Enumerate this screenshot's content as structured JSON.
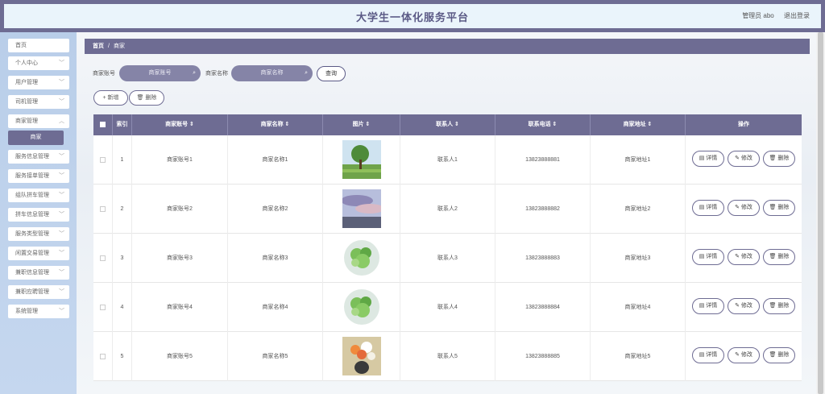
{
  "header": {
    "title": "大学生一体化服务平台",
    "user_label": "管理员 abo",
    "logout": "退出登录"
  },
  "sidebar": {
    "items": [
      {
        "label": "首页",
        "has_children": false
      },
      {
        "label": "个人中心",
        "has_children": true
      },
      {
        "label": "用户管理",
        "has_children": true
      },
      {
        "label": "司机管理",
        "has_children": true
      },
      {
        "label": "商家管理",
        "has_children": true
      },
      {
        "label": "服务信息管理",
        "has_children": true
      },
      {
        "label": "服务接单管理",
        "has_children": true
      },
      {
        "label": "组队拼车管理",
        "has_children": true
      },
      {
        "label": "拼车信息管理",
        "has_children": true
      },
      {
        "label": "服务类型管理",
        "has_children": true
      },
      {
        "label": "闲置交易管理",
        "has_children": true
      },
      {
        "label": "兼职信息管理",
        "has_children": true
      },
      {
        "label": "兼职应聘管理",
        "has_children": true
      },
      {
        "label": "系统管理",
        "has_children": true
      }
    ],
    "active_sub": "商家"
  },
  "breadcrumb": {
    "home": "首页",
    "sep": "/",
    "current": "商家"
  },
  "search": {
    "account_label": "商家账号",
    "account_placeholder": "商家账号",
    "name_label": "商家名称",
    "name_placeholder": "商家名称",
    "query_btn": "查询"
  },
  "actions": {
    "add": "+ 新增",
    "delete": "删除"
  },
  "table": {
    "columns": [
      "",
      "索引",
      "商家账号 ⇕",
      "商家名称 ⇕",
      "图片 ⇕",
      "联系人 ⇕",
      "联系电话 ⇕",
      "商家地址 ⇕",
      "操作"
    ],
    "rows": [
      {
        "index": "1",
        "account": "商家账号1",
        "name": "商家名称1",
        "image": "landscape-tree",
        "contact": "联系人1",
        "phone": "13823888881",
        "address": "商家地址1"
      },
      {
        "index": "2",
        "account": "商家账号2",
        "name": "商家名称2",
        "image": "sky-clouds",
        "contact": "联系人2",
        "phone": "13823888882",
        "address": "商家地址2"
      },
      {
        "index": "3",
        "account": "商家账号3",
        "name": "商家名称3",
        "image": "green-plant",
        "contact": "联系人3",
        "phone": "13823888883",
        "address": "商家地址3"
      },
      {
        "index": "4",
        "account": "商家账号4",
        "name": "商家名称4",
        "image": "green-plant",
        "contact": "联系人4",
        "phone": "13823888884",
        "address": "商家地址4"
      },
      {
        "index": "5",
        "account": "商家账号5",
        "name": "商家名称5",
        "image": "flower-vase",
        "contact": "联系人5",
        "phone": "13823888885",
        "address": "商家地址5"
      }
    ],
    "op_detail": "详情",
    "op_edit": "修改",
    "op_delete": "删除"
  },
  "colors": {
    "accent": "#6e6c93",
    "header_bg": "#eaf4fb",
    "sidebar_bg": "#c5d7ef"
  }
}
